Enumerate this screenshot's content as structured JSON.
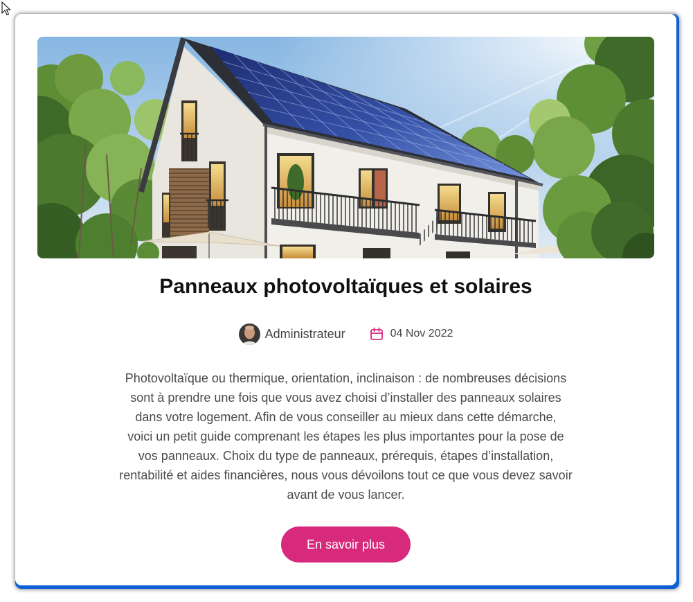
{
  "post": {
    "title": "Panneaux photovoltaïques et solaires",
    "author": {
      "name": "Administrateur",
      "avatar_icon": "avatar"
    },
    "date": "04 Nov 2022",
    "date_icon": "calendar-icon",
    "excerpt_lines": [
      "Photovoltaïque ou thermique, orientation, inclinaison : de nombreuses décisions",
      "sont à prendre une fois que vous avez choisi d’installer des panneaux solaires",
      "dans votre logement. Afin de vous conseiller au mieux dans cette démarche,",
      "voici un petit guide comprenant les étapes les plus importantes pour la pose de",
      "vos panneaux. Choix du type de panneaux, prérequis, étapes d’installation,",
      "rentabilité et aides financières, nous vous dévoilons tout ce que vous devez savoir",
      "avant de vous lancer."
    ],
    "cta_label": "En savoir plus"
  },
  "icons": {
    "cursor": "mouse-pointer-icon"
  },
  "colors": {
    "accent": "#d82a7c",
    "frame": "#0c5fd4",
    "title": "#111111",
    "text": "#4a4a4a"
  }
}
